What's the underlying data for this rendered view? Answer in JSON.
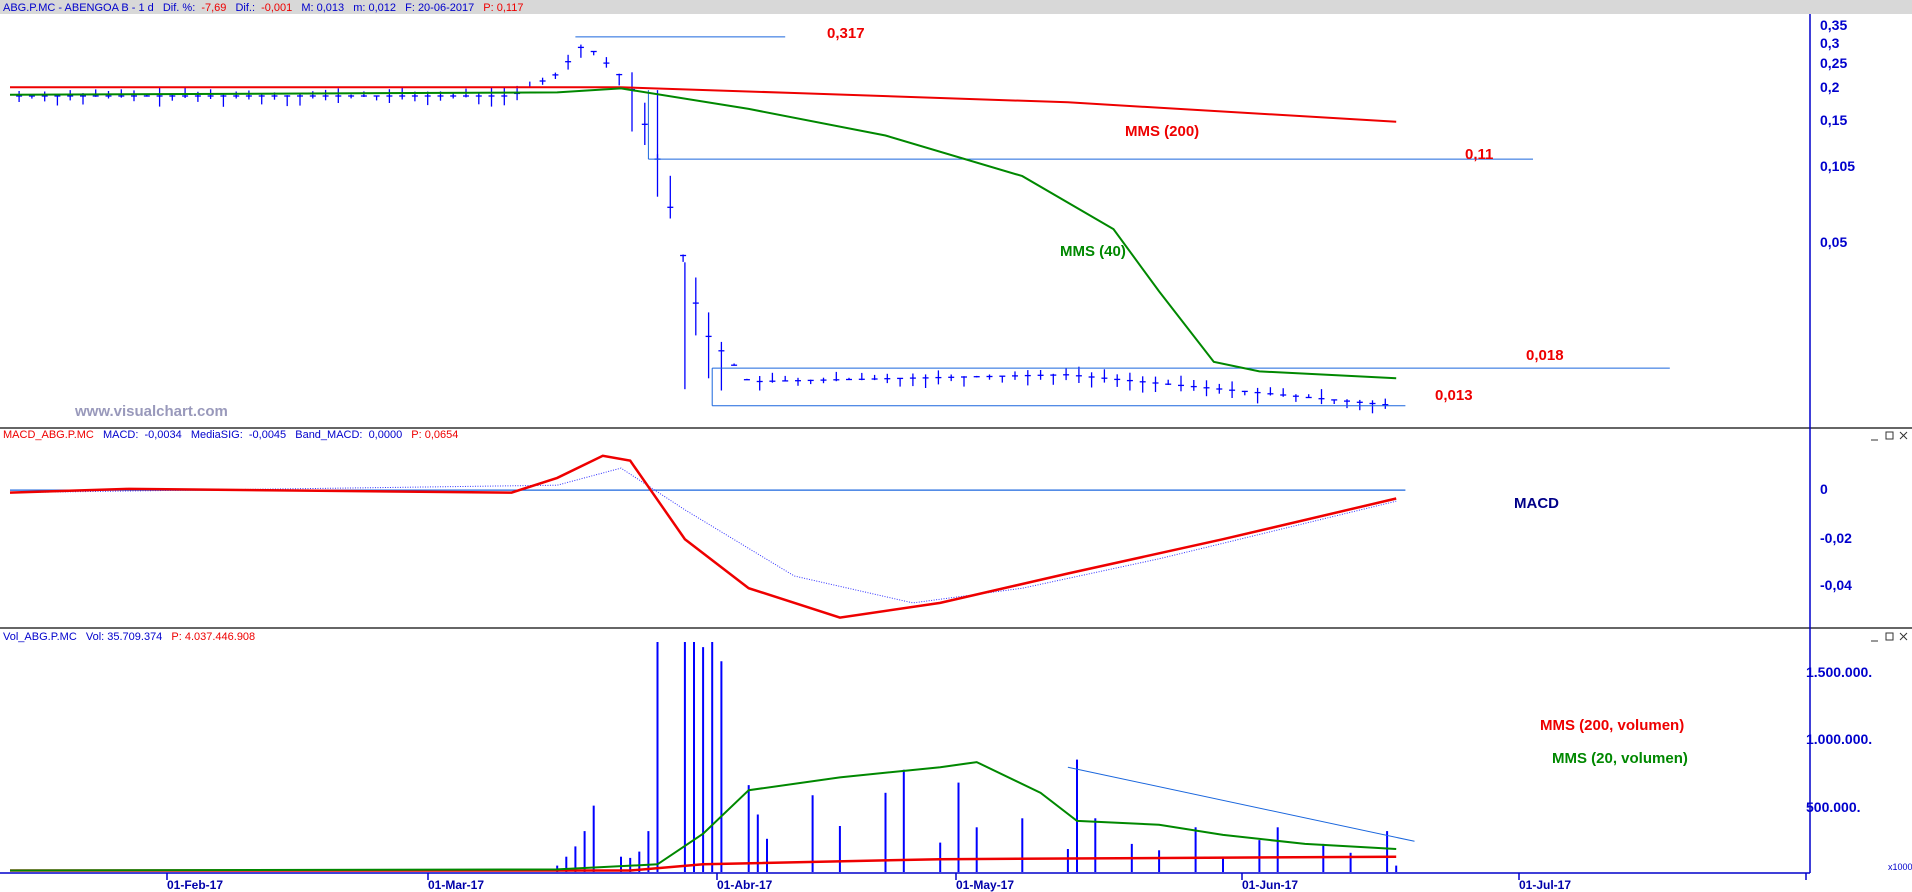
{
  "panels": {
    "price": {
      "header": {
        "symbol": "ABG.P.MC - ABENGOA B - 1 d",
        "dif_pct_label": "Dif. %:",
        "dif_pct": "-7,69",
        "dif_label": "Dif.:",
        "dif": "-0,001",
        "max_label": "M: 0,013",
        "min_label": "m: 0,012",
        "date_label": "F: 20-06-2017",
        "p_label": "P: 0,117"
      },
      "watermark": "www.visualchart.com",
      "y_ticks": [
        "0,35",
        "0,3",
        "0,25",
        "0,2",
        "0,15",
        "0,105",
        "0,05"
      ],
      "annotations": {
        "high": "0,317",
        "mid": "0,11",
        "resistance": "0,018",
        "support": "0,013",
        "mms200": "MMS (200)",
        "mms40": "MMS (40)"
      }
    },
    "macd": {
      "header": {
        "name": "MACD_ABG.P.MC",
        "macd_label": "MACD:",
        "macd": "-0,0034",
        "sig_label": "MediaSIG:",
        "sig": "-0,0045",
        "band_label": "Band_MACD:",
        "band": "0,0000",
        "p_label": "P: 0,0654"
      },
      "title": "MACD",
      "y_ticks": [
        "0",
        "-0,02",
        "-0,04"
      ]
    },
    "volume": {
      "header": {
        "name": "Vol_ABG.P.MC",
        "vol_label": "Vol: 35.709.374",
        "p_label": "P: 4.037.446.908"
      },
      "y_ticks": [
        "1.500.000.",
        "1.000.000.",
        "500.000."
      ],
      "scale_note": "x1000",
      "legend": {
        "mms200": "MMS (200, volumen)",
        "mms20": "MMS (20, volumen)"
      }
    }
  },
  "x_axis": {
    "labels": [
      "01-Feb-17",
      "01-Mar-17",
      "01-Abr-17",
      "01-May-17",
      "01-Jun-17",
      "01-Jul-17"
    ]
  },
  "colors": {
    "axis_blue": "#0000cc",
    "candle_blue": "#0000ff",
    "mms200_red": "#ee0000",
    "mms40_green": "#008800",
    "line_blue": "#1a66dd",
    "title_bar": "#d8d8d8"
  },
  "chart_data": [
    {
      "type": "line",
      "title": "ABG.P.MC - ABENGOA B - 1 d",
      "y_scale": "log",
      "ylim": [
        0.011,
        0.38
      ],
      "x_range": [
        "2017-01-19",
        "2017-07-31"
      ],
      "price_approx": [
        {
          "date": "2017-01-20",
          "close": 0.19
        },
        {
          "date": "2017-03-15",
          "close": 0.19
        },
        {
          "date": "2017-03-20",
          "close": 0.23
        },
        {
          "date": "2017-03-23",
          "close": 0.3
        },
        {
          "date": "2017-03-28",
          "close": 0.21
        },
        {
          "date": "2017-03-31",
          "close": 0.11
        },
        {
          "date": "2017-04-03",
          "close": 0.045
        },
        {
          "date": "2017-04-05",
          "close": 0.025
        },
        {
          "date": "2017-04-10",
          "close": 0.016
        },
        {
          "date": "2017-05-15",
          "close": 0.017
        },
        {
          "date": "2017-06-20",
          "close": 0.013
        }
      ],
      "series": [
        {
          "name": "MMS (200)",
          "points": [
            [
              "2017-01-19",
              0.205
            ],
            [
              "2017-03-27",
              0.205
            ],
            [
              "2017-04-15",
              0.195
            ],
            [
              "2017-05-15",
              0.18
            ],
            [
              "2017-06-20",
              0.152
            ]
          ]
        },
        {
          "name": "MMS (40)",
          "points": [
            [
              "2017-01-19",
              0.192
            ],
            [
              "2017-03-20",
              0.196
            ],
            [
              "2017-03-27",
              0.203
            ],
            [
              "2017-04-10",
              0.17
            ],
            [
              "2017-04-25",
              0.135
            ],
            [
              "2017-05-10",
              0.095
            ],
            [
              "2017-05-20",
              0.06
            ],
            [
              "2017-05-25",
              0.035
            ],
            [
              "2017-05-31",
              0.019
            ],
            [
              "2017-06-05",
              0.0175
            ],
            [
              "2017-06-20",
              0.0165
            ]
          ]
        }
      ],
      "levels": [
        {
          "label": "0,317",
          "value": 0.317,
          "from": "2017-03-22",
          "to": "2017-04-14"
        },
        {
          "label": "0,11",
          "value": 0.11,
          "from": "2017-03-30",
          "to": "2017-07-05"
        },
        {
          "label": "0,018",
          "value": 0.018,
          "from": "2017-04-06",
          "to": "2017-07-20"
        },
        {
          "label": "0,013",
          "value": 0.013,
          "from": "2017-04-06",
          "to": "2017-06-21"
        }
      ]
    },
    {
      "type": "line",
      "title": "MACD",
      "ylim": [
        -0.055,
        0.018
      ],
      "series": [
        {
          "name": "MACD",
          "points": [
            [
              "2017-01-19",
              -0.001
            ],
            [
              "2017-02-01",
              0.0005
            ],
            [
              "2017-03-15",
              -0.001
            ],
            [
              "2017-03-20",
              0.005
            ],
            [
              "2017-03-25",
              0.014
            ],
            [
              "2017-03-28",
              0.012
            ],
            [
              "2017-04-03",
              -0.02
            ],
            [
              "2017-04-10",
              -0.04
            ],
            [
              "2017-04-20",
              -0.052
            ],
            [
              "2017-05-01",
              -0.046
            ],
            [
              "2017-05-15",
              -0.034
            ],
            [
              "2017-06-01",
              -0.02
            ],
            [
              "2017-06-20",
              -0.0034
            ]
          ]
        },
        {
          "name": "MediaSIG",
          "points": [
            [
              "2017-01-19",
              -0.001
            ],
            [
              "2017-03-20",
              0.002
            ],
            [
              "2017-03-27",
              0.009
            ],
            [
              "2017-04-03",
              -0.008
            ],
            [
              "2017-04-15",
              -0.035
            ],
            [
              "2017-04-28",
              -0.046
            ],
            [
              "2017-05-10",
              -0.04
            ],
            [
              "2017-05-25",
              -0.028
            ],
            [
              "2017-06-20",
              -0.0045
            ]
          ]
        }
      ],
      "zero_line": 0
    },
    {
      "type": "bar",
      "title": "Vol_ABG.P.MC",
      "unit": "x1000",
      "ylim": [
        0,
        1800000
      ],
      "bars_approx": [
        {
          "date": "2017-03-20",
          "value": 50000
        },
        {
          "date": "2017-03-21",
          "value": 120000
        },
        {
          "date": "2017-03-22",
          "value": 200000
        },
        {
          "date": "2017-03-23",
          "value": 320000
        },
        {
          "date": "2017-03-24",
          "value": 520000
        },
        {
          "date": "2017-03-27",
          "value": 120000
        },
        {
          "date": "2017-03-28",
          "value": 110000
        },
        {
          "date": "2017-03-29",
          "value": 160000
        },
        {
          "date": "2017-03-30",
          "value": 320000
        },
        {
          "date": "2017-03-31",
          "value": 1800000
        },
        {
          "date": "2017-04-03",
          "value": 1800000
        },
        {
          "date": "2017-04-04",
          "value": 1800000
        },
        {
          "date": "2017-04-05",
          "value": 1760000
        },
        {
          "date": "2017-04-06",
          "value": 1800000
        },
        {
          "date": "2017-04-07",
          "value": 1650000
        },
        {
          "date": "2017-04-10",
          "value": 680000
        },
        {
          "date": "2017-04-11",
          "value": 450000
        },
        {
          "date": "2017-04-12",
          "value": 260000
        },
        {
          "date": "2017-04-17",
          "value": 600000
        },
        {
          "date": "2017-04-20",
          "value": 360000
        },
        {
          "date": "2017-04-25",
          "value": 620000
        },
        {
          "date": "2017-04-27",
          "value": 800000
        },
        {
          "date": "2017-05-01",
          "value": 230000
        },
        {
          "date": "2017-05-03",
          "value": 700000
        },
        {
          "date": "2017-05-05",
          "value": 350000
        },
        {
          "date": "2017-05-10",
          "value": 420000
        },
        {
          "date": "2017-05-15",
          "value": 180000
        },
        {
          "date": "2017-05-16",
          "value": 880000
        },
        {
          "date": "2017-05-18",
          "value": 420000
        },
        {
          "date": "2017-05-22",
          "value": 220000
        },
        {
          "date": "2017-05-25",
          "value": 170000
        },
        {
          "date": "2017-05-29",
          "value": 350000
        },
        {
          "date": "2017-06-01",
          "value": 120000
        },
        {
          "date": "2017-06-05",
          "value": 250000
        },
        {
          "date": "2017-06-07",
          "value": 350000
        },
        {
          "date": "2017-06-12",
          "value": 220000
        },
        {
          "date": "2017-06-15",
          "value": 150000
        },
        {
          "date": "2017-06-19",
          "value": 320000
        },
        {
          "date": "2017-06-20",
          "value": 50000
        }
      ],
      "series": [
        {
          "name": "MMS (200, volumen)",
          "points": [
            [
              "2017-01-19",
              12000
            ],
            [
              "2017-03-28",
              12000
            ],
            [
              "2017-04-05",
              60000
            ],
            [
              "2017-05-01",
              100000
            ],
            [
              "2017-06-20",
              120000
            ]
          ]
        },
        {
          "name": "MMS (20, volumen)",
          "points": [
            [
              "2017-01-19",
              12000
            ],
            [
              "2017-03-20",
              20000
            ],
            [
              "2017-03-31",
              60000
            ],
            [
              "2017-04-05",
              300000
            ],
            [
              "2017-04-10",
              640000
            ],
            [
              "2017-04-20",
              740000
            ],
            [
              "2017-05-01",
              820000
            ],
            [
              "2017-05-05",
              860000
            ],
            [
              "2017-05-12",
              620000
            ],
            [
              "2017-05-16",
              400000
            ],
            [
              "2017-05-25",
              370000
            ],
            [
              "2017-06-01",
              290000
            ],
            [
              "2017-06-10",
              220000
            ],
            [
              "2017-06-20",
              180000
            ]
          ]
        }
      ],
      "trendline": {
        "from": [
          "2017-05-15",
          820000
        ],
        "to": [
          "2017-06-22",
          240000
        ]
      }
    }
  ]
}
